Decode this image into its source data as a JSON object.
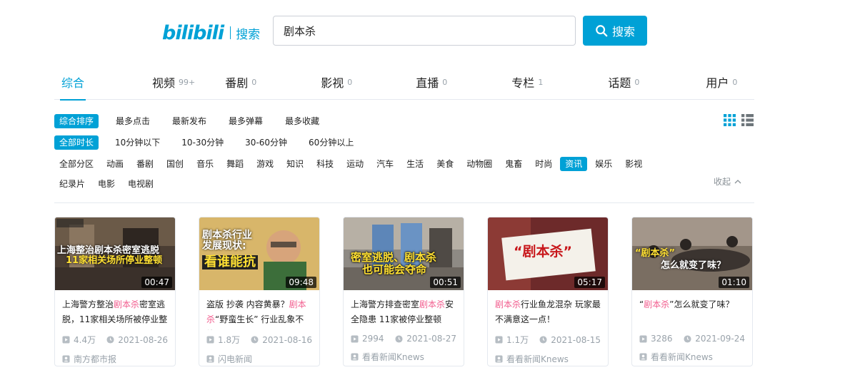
{
  "header": {
    "logo_text": "bilibili",
    "logo_sub": "搜索",
    "search_value": "剧本杀",
    "search_button": "搜索"
  },
  "tabs": [
    {
      "label": "综合",
      "count": ""
    },
    {
      "label": "视频",
      "count": "99+"
    },
    {
      "label": "番剧",
      "count": "0"
    },
    {
      "label": "影视",
      "count": "0"
    },
    {
      "label": "直播",
      "count": "0"
    },
    {
      "label": "专栏",
      "count": "1"
    },
    {
      "label": "话题",
      "count": "0"
    },
    {
      "label": "用户",
      "count": "0"
    }
  ],
  "filters": {
    "sort": [
      "综合排序",
      "最多点击",
      "最新发布",
      "最多弹幕",
      "最多收藏"
    ],
    "duration": [
      "全部时长",
      "10分钟以下",
      "10-30分钟",
      "30-60分钟",
      "60分钟以上"
    ],
    "zones": [
      "全部分区",
      "动画",
      "番剧",
      "国创",
      "音乐",
      "舞蹈",
      "游戏",
      "知识",
      "科技",
      "运动",
      "汽车",
      "生活",
      "美食",
      "动物圈",
      "鬼畜",
      "时尚",
      "资讯",
      "娱乐",
      "影视",
      "纪录片",
      "电影",
      "电视剧"
    ],
    "collapse": "收起"
  },
  "videos": [
    {
      "thumb_text": [
        "上海整治剧本杀密室逃脱",
        "11家相关场所停业整顿"
      ],
      "duration": "00:47",
      "title_pre": "上海警方整治",
      "title_hl": "剧本杀",
      "title_post": "密室逃脱，11家相关场所被停业整",
      "views": "4.4万",
      "date": "2021-08-26",
      "author": "南方都市报"
    },
    {
      "thumb_text": [
        "剧本杀行业",
        "发展现状:",
        "看谁能抗"
      ],
      "duration": "09:48",
      "title_pre": "盗版 抄袭 内容黄暴？",
      "title_hl": "剧本杀",
      "title_post": "“野蛮生长” 行业乱象不能",
      "views": "1.8万",
      "date": "2021-08-16",
      "author": "闪电新闻"
    },
    {
      "thumb_text": [
        "密室逃脱、剧本杀",
        "也可能会夺命"
      ],
      "duration": "00:51",
      "title_pre": "上海警方排查密室",
      "title_hl": "剧本杀",
      "title_post": "安全隐患 11家被停业整顿",
      "views": "2994",
      "date": "2021-08-27",
      "author": "看看新闻Knews"
    },
    {
      "thumb_text": [
        "“剧本杀”"
      ],
      "duration": "05:17",
      "title_pre": "",
      "title_hl": "剧本杀",
      "title_post": "行业鱼龙混杂 玩家最不满意这一点！",
      "views": "1.1万",
      "date": "2021-08-15",
      "author": "看看新闻Knews"
    },
    {
      "thumb_text": [
        "“剧本杀”",
        "怎么就变了味？"
      ],
      "duration": "01:10",
      "title_pre": "“",
      "title_hl": "剧本杀",
      "title_post": "”怎么就变了味？",
      "views": "3286",
      "date": "2021-09-24",
      "author": "看看新闻Knews"
    }
  ],
  "colors": {
    "accent": "#00a1d6",
    "highlight": "#f25d8e",
    "muted": "#99a2aa"
  }
}
